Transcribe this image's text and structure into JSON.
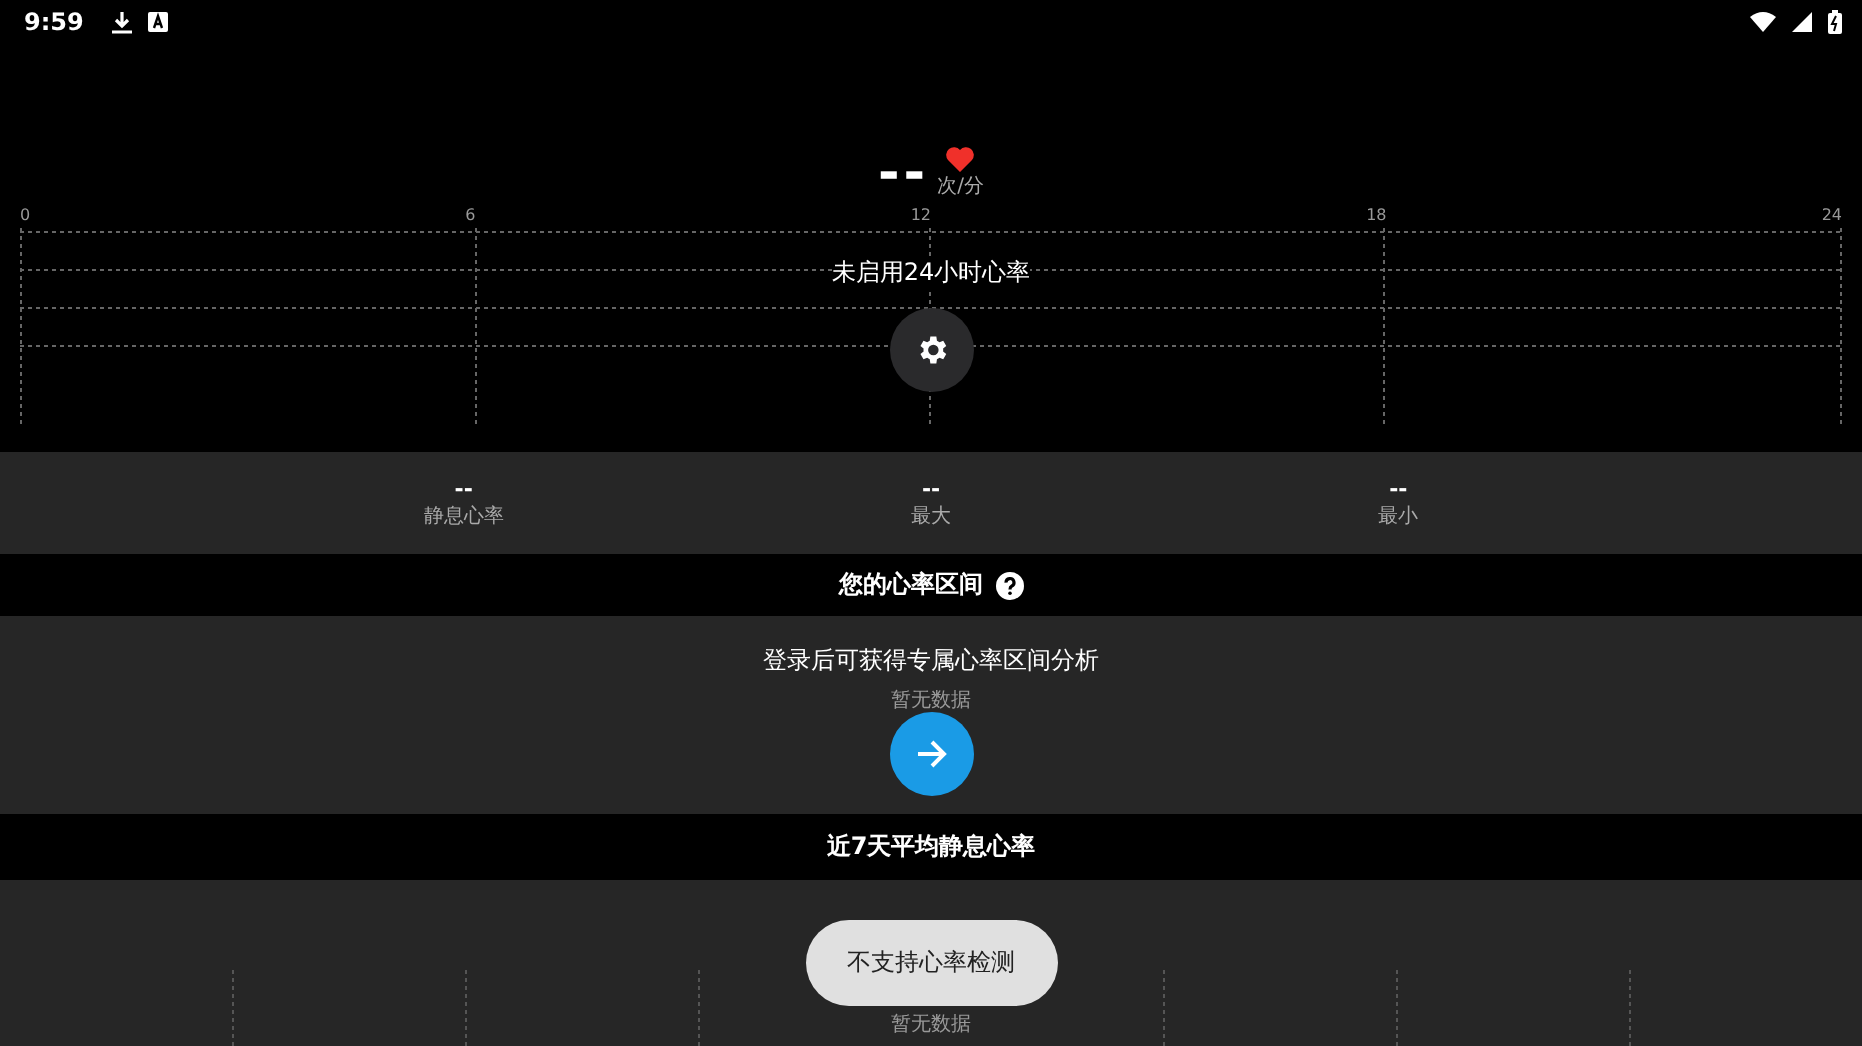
{
  "status_bar": {
    "time": "9:59"
  },
  "reading": {
    "value": "--",
    "unit": "次/分"
  },
  "day_chart": {
    "ticks": [
      "0",
      "6",
      "12",
      "18",
      "24"
    ],
    "message": "未启用24小时心率"
  },
  "stats": [
    {
      "value": "--",
      "label": "静息心率"
    },
    {
      "value": "--",
      "label": "最大"
    },
    {
      "value": "--",
      "label": "最小"
    }
  ],
  "zones": {
    "title": "您的心率区间",
    "notice": "登录后可获得专属心率区间分析",
    "empty": "暂无数据"
  },
  "week": {
    "title": "近7天平均静息心率",
    "empty": "暂无数据"
  },
  "toast": "不支持心率检测"
}
